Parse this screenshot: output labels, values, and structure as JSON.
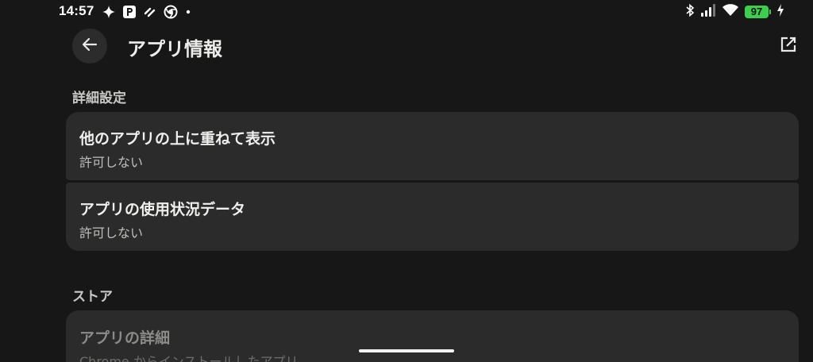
{
  "status_bar": {
    "time": "14:57",
    "battery_level": "97",
    "icons": [
      "sparkle-icon",
      "parking-app-icon",
      "stripes-app-icon",
      "chrome-icon",
      "dot-icon",
      "bluetooth-icon",
      "signal-icon",
      "wifi-icon",
      "battery-icon",
      "charging-bolt-icon"
    ]
  },
  "header": {
    "title": "アプリ情報",
    "back_icon": "arrow-left-icon",
    "open_icon": "open-external-icon"
  },
  "sections": {
    "advanced": {
      "header": "詳細設定",
      "items": [
        {
          "title": "他のアプリの上に重ねて表示",
          "subtitle": "許可しない"
        },
        {
          "title": "アプリの使用状況データ",
          "subtitle": "許可しない"
        }
      ]
    },
    "store": {
      "header": "ストア",
      "items": [
        {
          "title": "アプリの詳細",
          "subtitle": "Chrome からインストールしたアプリ"
        }
      ]
    }
  },
  "colors": {
    "background": "#161716",
    "card": "#2a2b2a",
    "battery": "#3ccf4e"
  }
}
